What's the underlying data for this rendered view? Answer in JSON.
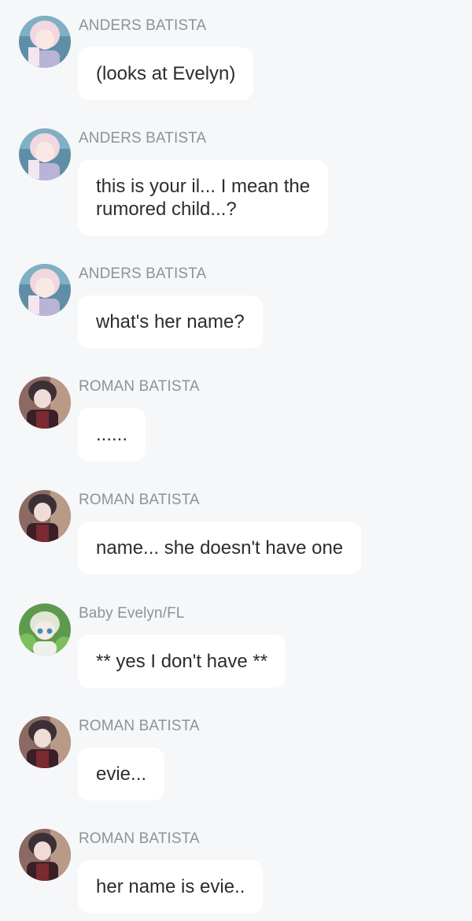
{
  "colors": {
    "background": "#f6f7f9",
    "bubble": "#ffffff",
    "name_text": "#8f9296",
    "message_text": "#2b2d30"
  },
  "messages": [
    {
      "sender": "ANDERS BATISTA",
      "avatar_icon": "anders-avatar-icon",
      "lines": [
        "(looks at Evelyn)"
      ]
    },
    {
      "sender": "ANDERS BATISTA",
      "avatar_icon": "anders-avatar-icon",
      "lines": [
        "this is your il... I mean the",
        "rumored child...?"
      ]
    },
    {
      "sender": "ANDERS BATISTA",
      "avatar_icon": "anders-avatar-icon",
      "lines": [
        "what's her name?"
      ]
    },
    {
      "sender": "ROMAN BATISTA",
      "avatar_icon": "roman-avatar-icon",
      "lines": [
        "......"
      ]
    },
    {
      "sender": "ROMAN BATISTA",
      "avatar_icon": "roman-avatar-icon",
      "lines": [
        "name... she doesn't have one"
      ]
    },
    {
      "sender": "Baby Evelyn/FL",
      "avatar_icon": "evelyn-avatar-icon",
      "lines": [
        "** yes I don't have **"
      ]
    },
    {
      "sender": "ROMAN BATISTA",
      "avatar_icon": "roman-avatar-icon",
      "lines": [
        "evie..."
      ]
    },
    {
      "sender": "ROMAN BATISTA",
      "avatar_icon": "roman-avatar-icon",
      "lines": [
        "her name is evie.."
      ]
    }
  ]
}
